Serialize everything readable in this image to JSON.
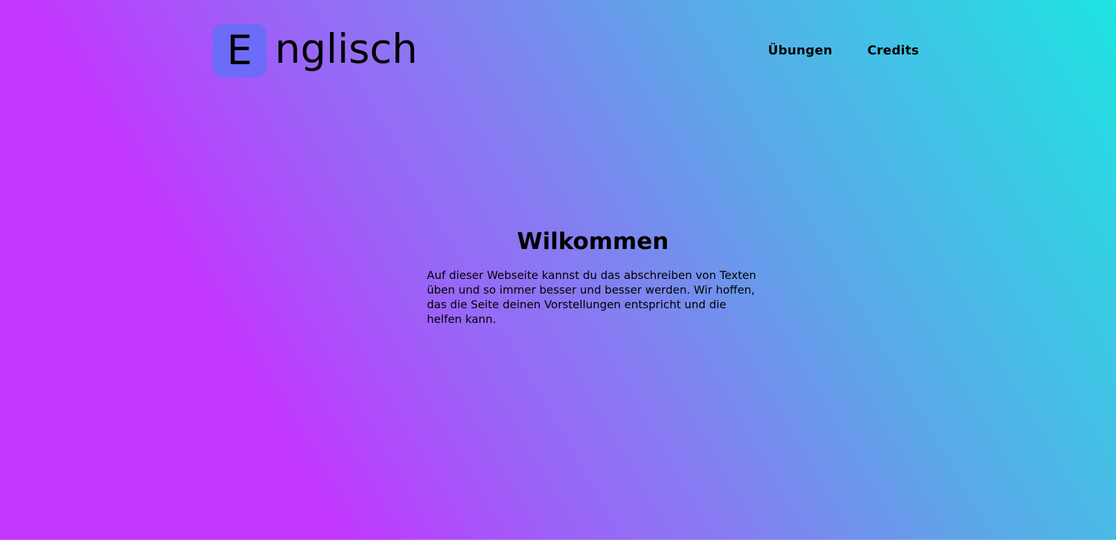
{
  "header": {
    "logo_letter": "E",
    "logo_text": "nglisch",
    "logo_accent_color": "#6c6cf9"
  },
  "nav": {
    "items": [
      {
        "label": "Übungen"
      },
      {
        "label": "Credits"
      }
    ]
  },
  "main": {
    "title": "Wilkommen",
    "body": "Auf dieser Webseite kannst du das abschreiben von Texten üben und so immer besser und besser werden. Wir hoffen, das die Seite deinen Vorstellungen entspricht und die helfen kann."
  },
  "theme": {
    "gradient_start": "#c236fe",
    "gradient_end": "#1fe4e2"
  }
}
